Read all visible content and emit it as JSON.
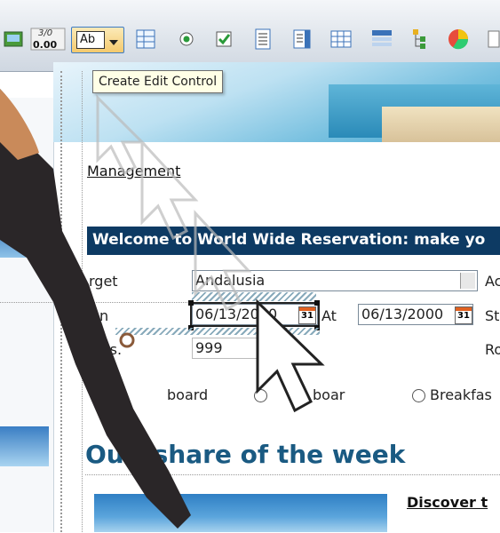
{
  "toolbar": {
    "counter_top": "3/0",
    "counter_bottom": "0.00",
    "edit_button_label": "Ab",
    "tooltip": "Create Edit Control",
    "icons": [
      "image-icon",
      "counter-icon",
      "edit-control-icon",
      "dropdown-arrow-icon",
      "table-icon",
      "radio-icon",
      "checkbox-icon",
      "listbox-icon",
      "list-icon",
      "grid-icon",
      "form-icon",
      "tree-icon",
      "pie-chart-icon"
    ]
  },
  "nav": {
    "management_link": "Management"
  },
  "band": {
    "text": "Welcome to World Wide Reservation: make yo"
  },
  "form": {
    "target_label": "rget",
    "target_value": "Andalusia",
    "date_label": "n",
    "date_value": "06/13/2000",
    "at_label": "At",
    "at_value": "06/13/2000",
    "members_label": "N     rs.",
    "members_value": "999",
    "right_label_1": "Ac",
    "right_label_2": "St",
    "right_label_3": "Ro",
    "calendar_icon_text": "31",
    "board_options": [
      "board",
      "boar",
      "Breakfas"
    ]
  },
  "promo": {
    "headline": "Ou     t share of the week",
    "discover_link": "Discover t"
  }
}
